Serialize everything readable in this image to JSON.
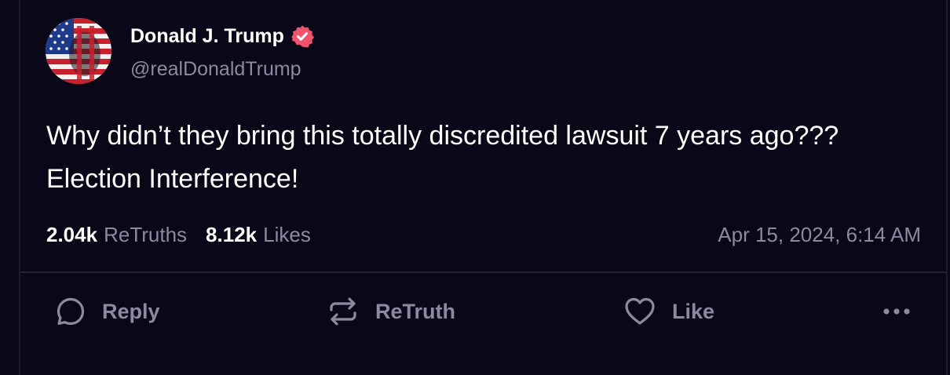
{
  "author": {
    "name": "Donald J. Trump",
    "handle": "@realDonaldTrump",
    "verified_color": "#f0546d"
  },
  "post": {
    "text": "Why didn’t they bring this totally discredited lawsuit 7 years ago??? Election Interference!"
  },
  "stats": {
    "retruths_count": "2.04k",
    "retruths_label": "ReTruths",
    "likes_count": "8.12k",
    "likes_label": "Likes",
    "timestamp": "Apr 15, 2024, 6:14 AM"
  },
  "actions": {
    "reply_label": "Reply",
    "retruth_label": "ReTruth",
    "like_label": "Like",
    "icons": [
      "reply-icon",
      "retruth-icon",
      "heart-icon",
      "more-icon"
    ]
  },
  "colors": {
    "background": "#0a0718",
    "muted_text": "#8c8aa0",
    "primary_text": "#ffffff"
  }
}
